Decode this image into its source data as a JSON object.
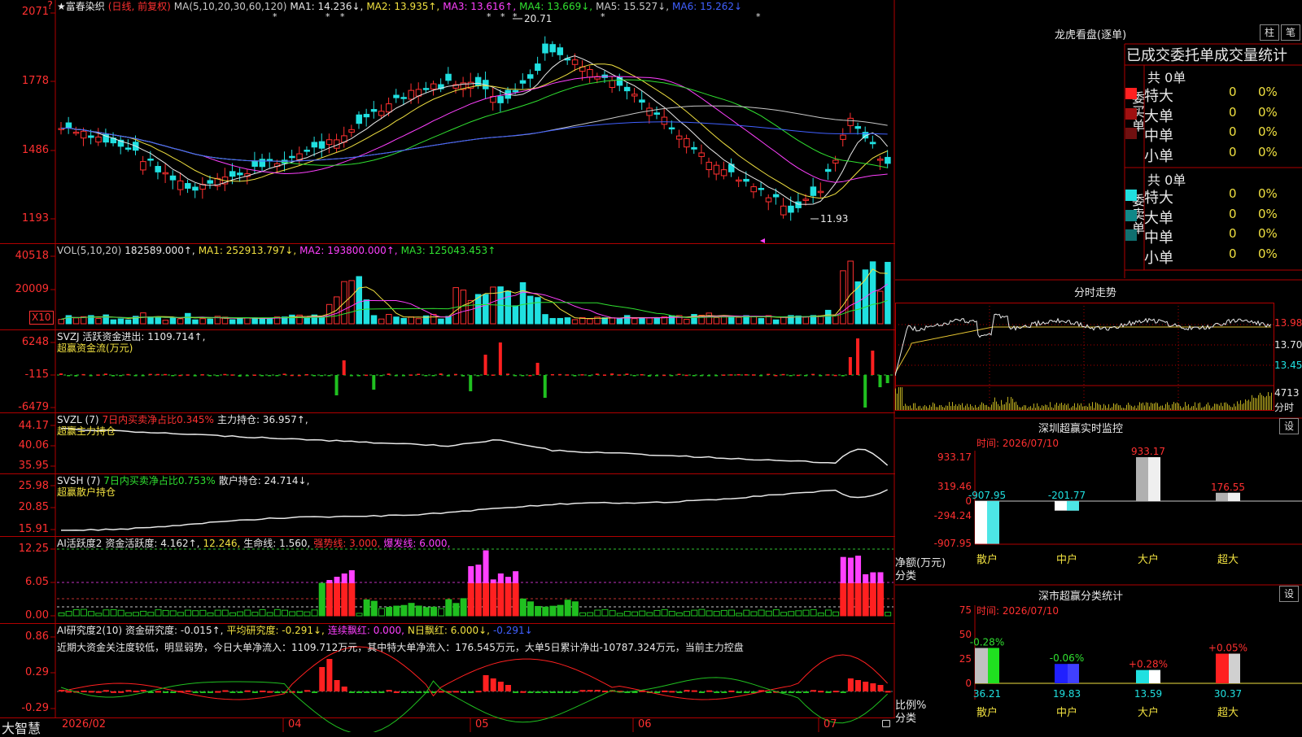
{
  "header": {
    "star": "★",
    "stock_name": "富春染织",
    "period": "(日线, 前复权)",
    "ma_label": "MA(5,10,20,30,60,120)",
    "mas": [
      {
        "label": "MA1: 14.236↓,",
        "color": "#e8e8e8"
      },
      {
        "label": "MA2: 13.935↑,",
        "color": "#f0e040"
      },
      {
        "label": "MA3: 13.616↑,",
        "color": "#ff40ff"
      },
      {
        "label": "MA4: 13.669↓,",
        "color": "#30e030"
      },
      {
        "label": "MA5: 15.527↓,",
        "color": "#c8c8c8"
      },
      {
        "label": "MA6: 15.262↓",
        "color": "#4060ff"
      }
    ],
    "high_label": "20.71",
    "low_label": "11.93"
  },
  "main_axis": {
    "ticks": [
      "2071",
      "1778",
      "1486",
      "1193"
    ]
  },
  "vol_panel": {
    "title": "VOL(5,10,20)",
    "value": "182589.000↑,",
    "mas": [
      {
        "label": "MA1: 252913.797↓,",
        "color": "#f0e040"
      },
      {
        "label": "MA2: 193800.000↑,",
        "color": "#ff40ff"
      },
      {
        "label": "MA3: 125043.453↑",
        "color": "#30e030"
      }
    ],
    "ticks": [
      "40518",
      "20009"
    ],
    "unit": "X10"
  },
  "svzj_panel": {
    "title": "SVZJ  活跃资金进出: 1109.714↑,",
    "subtitle": "超赢资金流(万元)",
    "ticks": [
      "6248",
      "-115",
      "-6479"
    ]
  },
  "svzl_panel": {
    "title": "SVZL (7)",
    "ratio": "7日内买卖净占比0.345%",
    "hold": "主力持仓: 36.957↑,",
    "subtitle": "超赢主力持仓",
    "ticks": [
      "44.17",
      "40.06",
      "35.95"
    ]
  },
  "svsh_panel": {
    "title": "SVSH (7)",
    "ratio": "7日内买卖净占比0.753%",
    "hold": "散户持仓: 24.714↓,",
    "subtitle": "超赢散户持仓",
    "ticks": [
      "25.98",
      "20.85",
      "15.91"
    ]
  },
  "ai2_panel": {
    "title": "AI活跃度2",
    "items": [
      {
        "label": "资金活跃度: 4.162↑,",
        "color": "#e8e8e8"
      },
      {
        "label": "12.246,",
        "color": "#f0e040"
      },
      {
        "label": "生命线: 1.560,",
        "color": "#e8e8e8"
      },
      {
        "label": "强势线: 3.000,",
        "color": "#ff3030"
      },
      {
        "label": "爆发线: 6.000,",
        "color": "#ff40ff"
      }
    ],
    "ticks": [
      "12.25",
      "6.05",
      "0.00"
    ]
  },
  "ai_res_panel": {
    "title": "AI研究度2(10)",
    "items": [
      {
        "label": "资金研究度: -0.015↑,",
        "color": "#e8e8e8"
      },
      {
        "label": "平均研究度: -0.291↓,",
        "color": "#f0e040"
      },
      {
        "label": "连续飘红: 0.000,",
        "color": "#ff40ff"
      },
      {
        "label": "N日飘红: 6.000↓,",
        "color": "#f0e040"
      },
      {
        "label": "-0.291↓",
        "color": "#4060ff"
      }
    ],
    "comment": "近期大资金关注度较低，明显弱势，今日大单净流入：1109.712万元，其中特大单净流入：176.545万元，大单5日累计净出-10787.324万元，当前主力控盘",
    "ticks": [
      "0.86",
      "0.29",
      "-0.29"
    ]
  },
  "footer": {
    "brand": "大智慧",
    "dates": [
      "2026/02",
      "04",
      "05",
      "06",
      "07"
    ]
  },
  "right": {
    "dragon_title": "龙虎看盘(逐单)",
    "btn_bar": "柱",
    "btn_bi": "笔",
    "order_header": "已成交委托单成交量统计",
    "buy": {
      "side_label": "委买单",
      "total": "共 0单",
      "rows": [
        {
          "label": "特大",
          "count": "0",
          "pct": "0%",
          "color": "#ff2020"
        },
        {
          "label": "大单",
          "count": "0",
          "pct": "0%",
          "color": "#a01010"
        },
        {
          "label": "中单",
          "count": "0",
          "pct": "0%",
          "color": "#701010"
        },
        {
          "label": "小单",
          "count": "0",
          "pct": "0%",
          "color": "#000000"
        }
      ]
    },
    "sell": {
      "side_label": "委卖单",
      "total": "共 0单",
      "rows": [
        {
          "label": "特大",
          "count": "0",
          "pct": "0%",
          "color": "#20e0e0"
        },
        {
          "label": "大单",
          "count": "0",
          "pct": "0%",
          "color": "#108888"
        },
        {
          "label": "中单",
          "count": "0",
          "pct": "0%",
          "color": "#107070"
        },
        {
          "label": "小单",
          "count": "0",
          "pct": "0%",
          "color": "#000000"
        }
      ]
    },
    "intraday": {
      "title": "分时走势",
      "prices": [
        "13.98",
        "13.70",
        "13.45"
      ],
      "vol": "4713",
      "vol_label": "分时"
    },
    "sz_monitor": {
      "title": "深圳超赢实时监控",
      "set": "设",
      "time": "时间: 2026/07/10",
      "ticks": [
        "933.17",
        "319.46",
        "0",
        "-294.24",
        "-907.95"
      ],
      "unit": "净额(万元)",
      "cat_label": "分类",
      "categories": [
        "散户",
        "中户",
        "大户",
        "超大"
      ],
      "values": [
        -907.95,
        -201.77,
        933.17,
        176.55
      ],
      "value_labels": [
        "-907.95",
        "-201.77",
        "933.17",
        "176.55"
      ]
    },
    "sz_classify": {
      "title": "深市超赢分类统计",
      "set": "设",
      "time": "时间: 2026/07/10",
      "ticks": [
        "75",
        "50",
        "25",
        "0"
      ],
      "unit": "比例%",
      "cat_label": "分类",
      "categories": [
        "散户",
        "中户",
        "大户",
        "超大"
      ],
      "values": [
        36.21,
        19.83,
        13.59,
        30.37
      ],
      "value_labels": [
        "36.21",
        "19.83",
        "13.59",
        "30.37"
      ],
      "changes": [
        "-0.28%",
        "-0.06%",
        "+0.28%",
        "+0.05%"
      ]
    }
  }
}
